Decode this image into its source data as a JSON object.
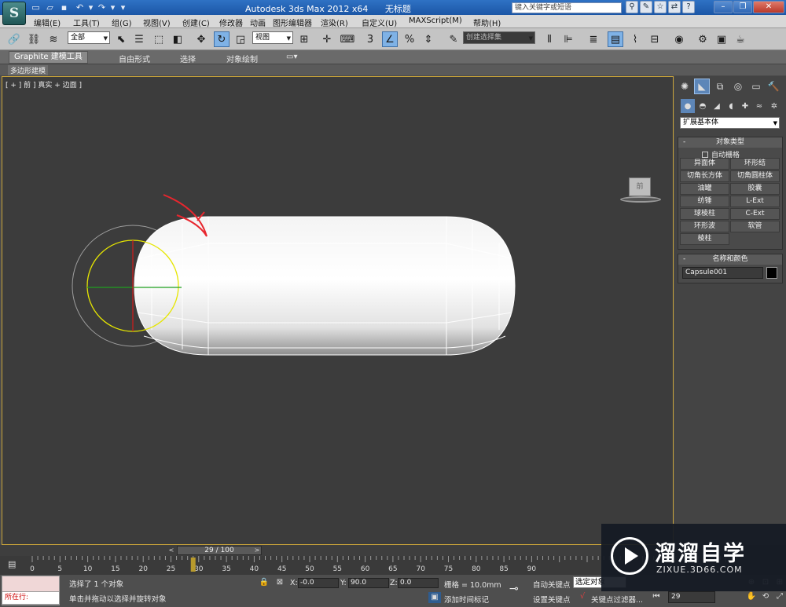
{
  "titlebar": {
    "app_title": "Autodesk 3ds Max  2012 x64",
    "doc_title": "无标题",
    "logo": "S",
    "search_placeholder": "键入关键字或短语"
  },
  "menu": {
    "items": [
      "编辑(E)",
      "工具(T)",
      "组(G)",
      "视图(V)",
      "创建(C)",
      "修改器",
      "动画",
      "图形编辑器",
      "渲染(R)",
      "自定义(U)",
      "MAXScript(M)",
      "帮助(H)"
    ]
  },
  "toolbar": {
    "selection_filter": "全部",
    "reference_coord": "视图",
    "named_selection": "创建选择集",
    "snap_label": "3"
  },
  "ribbon": {
    "tabs": [
      "Graphite 建模工具",
      "自由形式",
      "选择",
      "对象绘制"
    ],
    "active_tab": "Graphite 建模工具",
    "subtab": "多边形建模"
  },
  "viewport": {
    "label": "[ + ] 前 ] 真实 + 边面 ]",
    "viewcube_label": "前",
    "annotation_color": "#e8262e",
    "selection_ring_color": "#e6e600",
    "highlight_border": "#c9a43a"
  },
  "command_panel": {
    "category_dropdown": "扩展基本体",
    "object_type": {
      "header": "对象类型",
      "autogrid": "自动栅格",
      "buttons": [
        "异面体",
        "环形结",
        "切角长方体",
        "切角圆柱体",
        "油罐",
        "胶囊",
        "纺锤",
        "L-Ext",
        "球棱柱",
        "C-Ext",
        "环形波",
        "软管",
        "棱柱"
      ]
    },
    "name_color": {
      "header": "名称和颜色",
      "name_value": "Capsule001",
      "color": "#000000"
    }
  },
  "timeline": {
    "frame_display": "29 / 100",
    "current_frame": 29,
    "total_frames": 100,
    "tick_labels": [
      "0",
      "5",
      "10",
      "15",
      "20",
      "25",
      "30",
      "35",
      "40",
      "45",
      "50",
      "55",
      "60",
      "65",
      "70",
      "75",
      "80",
      "85",
      "90"
    ]
  },
  "status": {
    "maxscript_label": "所在行:",
    "selection_info": "选择了 1 个对象",
    "prompt": "单击并拖动以选择并旋转对象",
    "x_label": "X:",
    "x_value": "-0.0",
    "y_label": "Y:",
    "y_value": "90.0",
    "z_label": "Z:",
    "z_value": "0.0",
    "grid": "栅格 = 10.0mm",
    "add_time_tag": "添加时间标记",
    "auto_key": "自动关键点",
    "selected_dropdown": "选定对象",
    "set_key": "设置关键点",
    "key_filters": "关键点过滤器...",
    "frame_value": "29"
  },
  "watermark": {
    "title": "溜溜自学",
    "url": "ZIXUE.3D66.COM"
  }
}
